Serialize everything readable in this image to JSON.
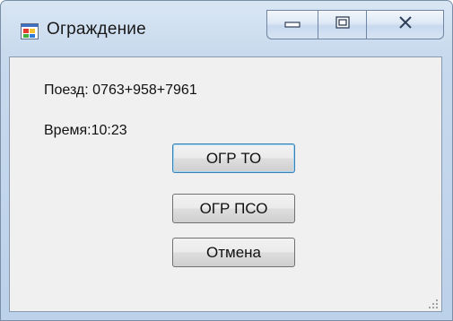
{
  "window": {
    "title": "Ограждение",
    "icon": "app-window-icon",
    "caption_buttons": [
      "minimize-icon",
      "maximize-icon",
      "close-icon"
    ]
  },
  "labels": {
    "train": "Поезд: 0763+958+7961",
    "time": "Время:10:23"
  },
  "buttons": {
    "ogr_to": "ОГР ТО",
    "ogr_pso": "ОГР ПСО",
    "cancel": "Отмена"
  },
  "colors": {
    "frame": "#c7d9ed",
    "client": "#f0f0f0",
    "focus_border": "#3c7fb1"
  }
}
